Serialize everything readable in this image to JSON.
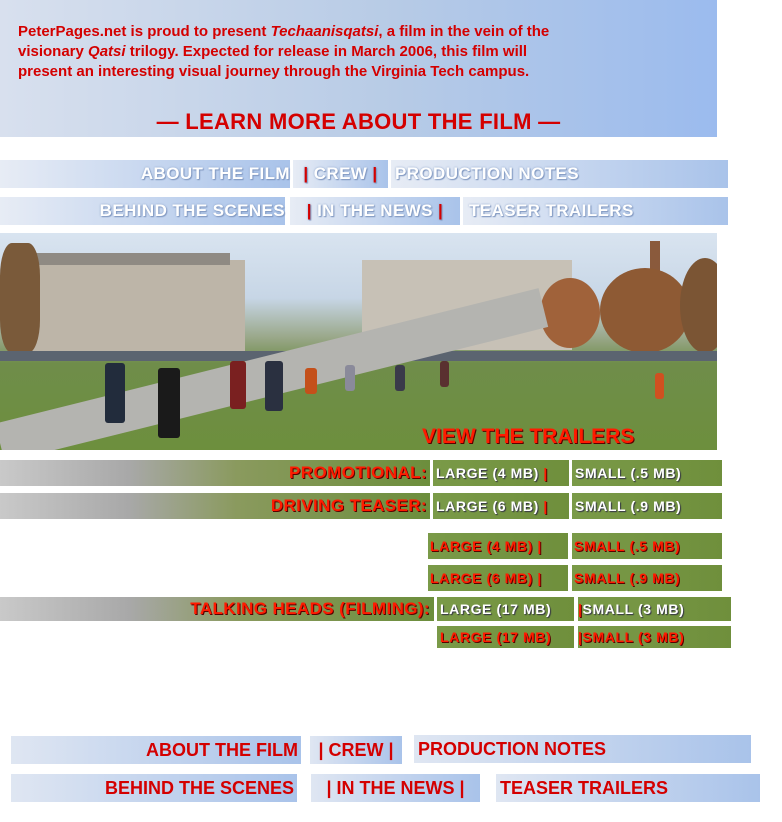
{
  "intro": {
    "line1_pre": "PeterPages.net is proud to present ",
    "film_title": "Techaanisqatsi",
    "line1_post": ", a film in the vein of the",
    "line2_pre": "visionary ",
    "trilogy": "Qatsi",
    "line2_post": " trilogy.  Expected for release in March 2006, this film will",
    "line3": "present an interesting visual journey through the Virginia Tech campus.",
    "learn_more": "— LEARN MORE ABOUT THE FILM —"
  },
  "top_nav": {
    "about": "ABOUT THE FILM",
    "crew": "CREW",
    "production": "PRODUCTION NOTES",
    "behind": "BEHIND THE SCENES",
    "news": "IN THE NEWS",
    "teaser": "TEASER TRAILERS",
    "sep": "|"
  },
  "trailers": {
    "heading": "VIEW THE TRAILERS",
    "rows": [
      {
        "label": "PROMOTIONAL:",
        "large": "LARGE (4 MB)",
        "small": "SMALL (.5 MB)"
      },
      {
        "label": "DRIVING TEASER:",
        "large": "LARGE (6 MB)",
        "small": "SMALL (.9 MB)"
      },
      {
        "label": "",
        "large": "LARGE (4 MB)",
        "small": "SMALL (.5 MB)"
      },
      {
        "label": "",
        "large": "LARGE (6 MB)",
        "small": "SMALL (.9 MB)"
      },
      {
        "label": "TALKING HEADS (FILMING):",
        "large": "LARGE (17 MB)",
        "small": "SMALL (3 MB)"
      },
      {
        "label": "",
        "large": "LARGE (17 MB)",
        "small": "SMALL (3 MB)"
      }
    ],
    "sep": "|"
  },
  "bottom_nav": {
    "about": "ABOUT THE FILM",
    "crew": "| CREW |",
    "production": "PRODUCTION NOTES",
    "behind": "BEHIND THE SCENES",
    "news": "| IN THE NEWS |",
    "teaser": "TEASER TRAILERS"
  },
  "colors": {
    "accent_red": "#d40000",
    "banner_blue": "#a9c3ea",
    "grass_green": "#6f8f3c"
  }
}
